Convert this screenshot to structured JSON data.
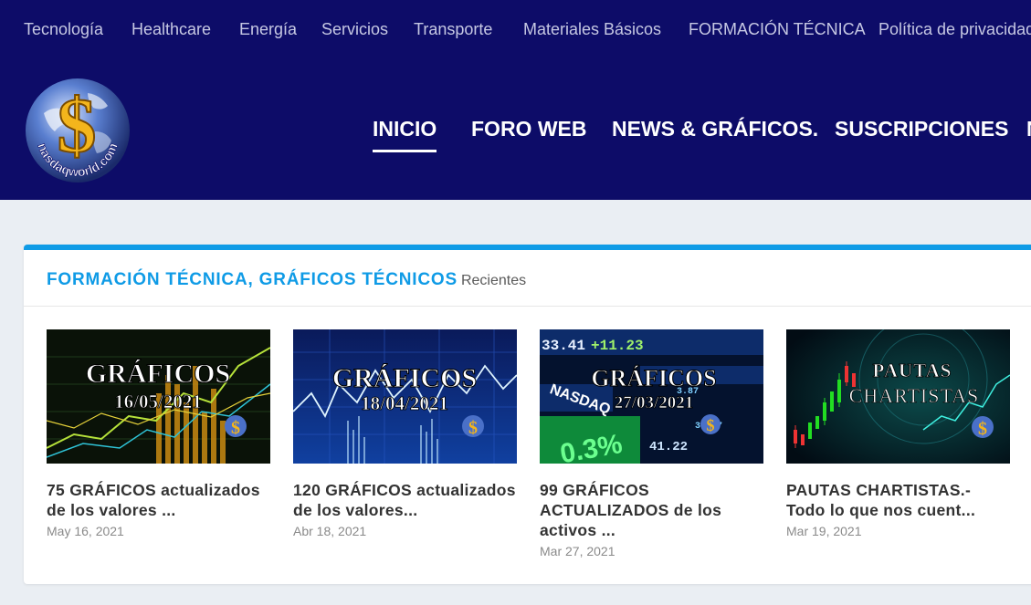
{
  "topnav": [
    "Tecnología",
    "Healthcare",
    "Energía",
    "Servicios",
    "Transporte",
    "Materiales Básicos",
    "FORMACIÓN TÉCNICA",
    "Política de privacidad"
  ],
  "logo": {
    "text": "nasdaqworld.com",
    "symbol": "$"
  },
  "mainnav": [
    "INICIO",
    "FORO WEB",
    "NEWS & GRÁFICOS.",
    "SUSCRIPCIONES",
    "N"
  ],
  "section": {
    "title": "FORMACIÓN TÉCNICA, GRÁFICOS TÉCNICOS",
    "subtitle": "Recientes"
  },
  "cards": [
    {
      "img_line1": "GRÁFICOS",
      "img_line2": "16/05/2021",
      "title": "75 GRÁFICOS actualizados de los valores ...",
      "date": "May 16, 2021"
    },
    {
      "img_line1": "GRÁFICOS",
      "img_line2": "18/04/2021",
      "title": "120 GRÁFICOS actualizados de los valores...",
      "date": "Abr 18, 2021"
    },
    {
      "img_line1": "GRÁFICOS",
      "img_line2": "27/03/2021",
      "title": "99 GRÁFICOS ACTUALIZADOS de los activos ...",
      "date": "Mar 27, 2021"
    },
    {
      "img_line1": "PAUTAS",
      "img_line2": "CHARTISTAS",
      "title": "PAUTAS CHARTISTAS.- Todo lo que nos cuent...",
      "date": "Mar 19, 2021"
    }
  ],
  "colors": {
    "header": "#0d0c68",
    "accent": "#0f9be6",
    "gold": "#f3b51c"
  }
}
